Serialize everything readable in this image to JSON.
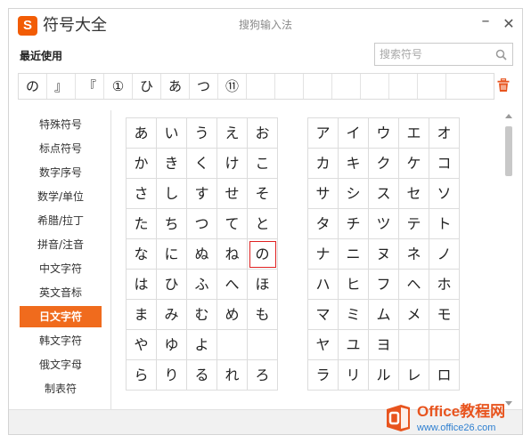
{
  "titlebar": {
    "logo_letter": "S",
    "app_title": "符号大全",
    "ime_name": "搜狗输入法",
    "minimize_symbol": "–",
    "close_symbol": "✕"
  },
  "recent": {
    "label": "最近使用",
    "items": [
      "の",
      "』",
      "『",
      "①",
      "ひ",
      "あ",
      "つ",
      "⑪",
      "",
      "",
      "",
      "",
      "",
      "",
      "",
      ""
    ]
  },
  "search": {
    "placeholder": "搜索符号",
    "value": ""
  },
  "sidebar": {
    "items": [
      {
        "label": "特殊符号",
        "active": false
      },
      {
        "label": "标点符号",
        "active": false
      },
      {
        "label": "数字序号",
        "active": false
      },
      {
        "label": "数学/单位",
        "active": false
      },
      {
        "label": "希腊/拉丁",
        "active": false
      },
      {
        "label": "拼音/注音",
        "active": false
      },
      {
        "label": "中文字符",
        "active": false
      },
      {
        "label": "英文音标",
        "active": false
      },
      {
        "label": "日文字符",
        "active": true
      },
      {
        "label": "韩文字符",
        "active": false
      },
      {
        "label": "俄文字母",
        "active": false
      },
      {
        "label": "制表符",
        "active": false
      }
    ]
  },
  "hiragana": [
    [
      "あ",
      "い",
      "う",
      "え",
      "お"
    ],
    [
      "か",
      "き",
      "く",
      "け",
      "こ"
    ],
    [
      "さ",
      "し",
      "す",
      "せ",
      "そ"
    ],
    [
      "た",
      "ち",
      "つ",
      "て",
      "と"
    ],
    [
      "な",
      "に",
      "ぬ",
      "ね",
      "の"
    ],
    [
      "は",
      "ひ",
      "ふ",
      "へ",
      "ほ"
    ],
    [
      "ま",
      "み",
      "む",
      "め",
      "も"
    ],
    [
      "や",
      "ゆ",
      "よ",
      "",
      ""
    ],
    [
      "ら",
      "り",
      "る",
      "れ",
      "ろ"
    ]
  ],
  "katakana": [
    [
      "ア",
      "イ",
      "ウ",
      "エ",
      "オ"
    ],
    [
      "カ",
      "キ",
      "ク",
      "ケ",
      "コ"
    ],
    [
      "サ",
      "シ",
      "ス",
      "セ",
      "ソ"
    ],
    [
      "タ",
      "チ",
      "ツ",
      "テ",
      "ト"
    ],
    [
      "ナ",
      "ニ",
      "ヌ",
      "ネ",
      "ノ"
    ],
    [
      "ハ",
      "ヒ",
      "フ",
      "ヘ",
      "ホ"
    ],
    [
      "マ",
      "ミ",
      "ム",
      "メ",
      "モ"
    ],
    [
      "ヤ",
      "ユ",
      "ヨ",
      "",
      ""
    ],
    [
      "ラ",
      "リ",
      "ル",
      "レ",
      "ロ"
    ]
  ],
  "selected_symbol": "の",
  "watermark": {
    "title": "Office教程网",
    "url": "www.office26.com"
  },
  "colors": {
    "accent": "#f06b1d",
    "selection_border": "#e02020",
    "watermark_orange": "#e8541e",
    "watermark_blue": "#2e7fd0"
  }
}
